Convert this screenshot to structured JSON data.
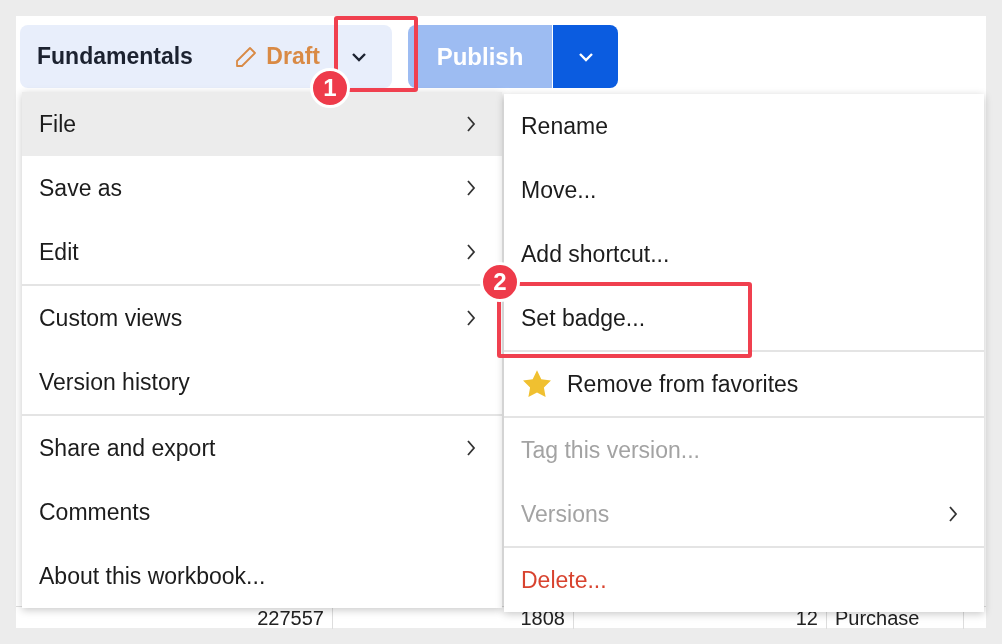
{
  "header": {
    "title": "Fundamentals",
    "status": "Draft",
    "publish": "Publish"
  },
  "menu": [
    {
      "label": "File",
      "submenu": true,
      "selected": true,
      "divider_before": false
    },
    {
      "label": "Save as",
      "submenu": true,
      "selected": false,
      "divider_before": false
    },
    {
      "label": "Edit",
      "submenu": true,
      "selected": false,
      "divider_before": false
    },
    {
      "label": "Custom views",
      "submenu": true,
      "selected": false,
      "divider_before": true
    },
    {
      "label": "Version history",
      "submenu": false,
      "selected": false,
      "divider_before": false
    },
    {
      "label": "Share and export",
      "submenu": true,
      "selected": false,
      "divider_before": true
    },
    {
      "label": "Comments",
      "submenu": false,
      "selected": false,
      "divider_before": false
    },
    {
      "label": "About this workbook...",
      "submenu": false,
      "selected": false,
      "divider_before": false
    }
  ],
  "submenu": [
    {
      "kind": "normal",
      "label": "Rename",
      "disabled": false,
      "submenu": false,
      "divider_before": false
    },
    {
      "kind": "normal",
      "label": "Move...",
      "disabled": false,
      "submenu": false,
      "divider_before": false
    },
    {
      "kind": "normal",
      "label": "Add shortcut...",
      "disabled": false,
      "submenu": false,
      "divider_before": false
    },
    {
      "kind": "normal",
      "label": "Set badge...",
      "disabled": false,
      "submenu": false,
      "divider_before": false
    },
    {
      "kind": "favorite",
      "label": "Remove from favorites",
      "disabled": false,
      "submenu": false,
      "divider_before": true
    },
    {
      "kind": "normal",
      "label": "Tag this version...",
      "disabled": true,
      "submenu": false,
      "divider_before": true
    },
    {
      "kind": "normal",
      "label": "Versions",
      "disabled": true,
      "submenu": true,
      "divider_before": false
    },
    {
      "kind": "danger",
      "label": "Delete...",
      "disabled": false,
      "submenu": false,
      "divider_before": true
    }
  ],
  "annotations": [
    {
      "number": "1"
    },
    {
      "number": "2"
    }
  ],
  "table_row": [
    "227557",
    "1808",
    "12",
    "Purchase"
  ]
}
